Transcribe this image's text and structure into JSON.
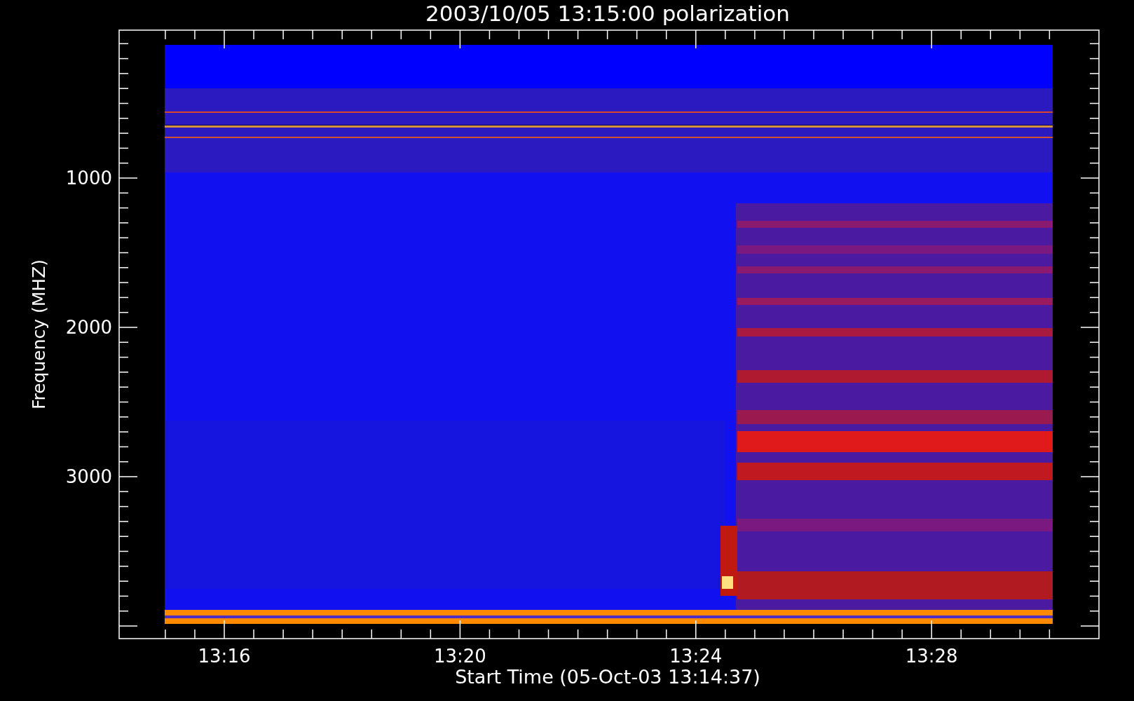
{
  "title": "2003/10/05 13:15:00 polarization",
  "xlabel": "Start Time (05-Oct-03 13:14:37)",
  "ylabel": "Frequency (MHZ)",
  "xtick_labels": [
    "13:16",
    "13:20",
    "13:24",
    "13:28"
  ],
  "ytick_labels": [
    "1000",
    "2000",
    "3000"
  ]
}
